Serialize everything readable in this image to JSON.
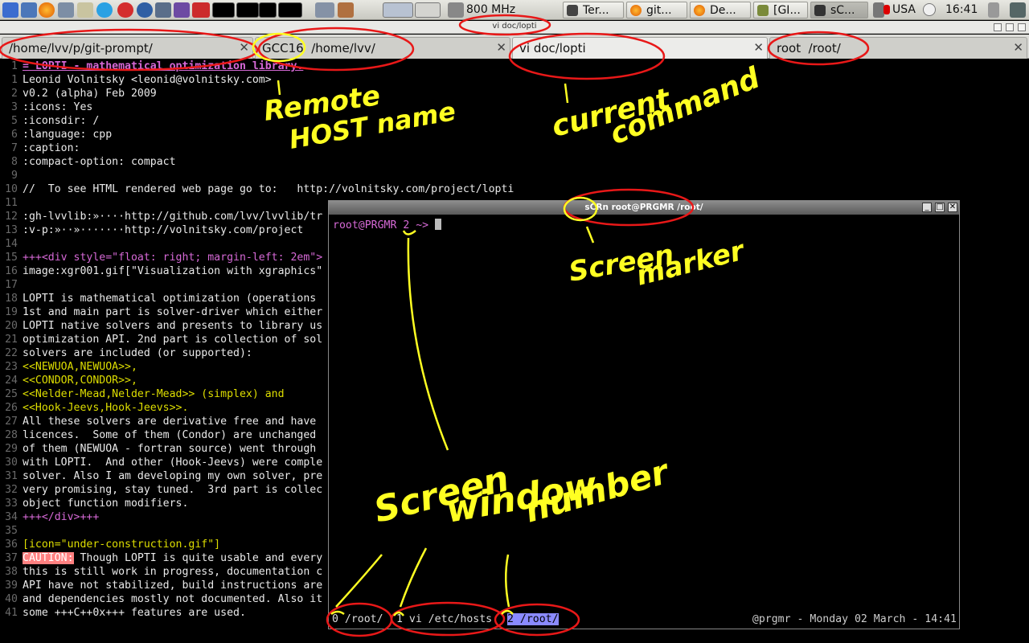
{
  "panel": {
    "cpu_freq": "800 MHz",
    "tasks": [
      {
        "label": "Ter...",
        "icon": "terminal-icon"
      },
      {
        "label": "git...",
        "icon": "firefox-icon"
      },
      {
        "label": "De...",
        "icon": "firefox-icon"
      },
      {
        "label": "[GI...",
        "icon": "gimp-icon"
      },
      {
        "label": "sC...",
        "icon": "terminal-icon"
      }
    ],
    "keyboard_layout": "USA",
    "clock": "16:41"
  },
  "window": {
    "title": "vi doc/lopti"
  },
  "tabs": [
    {
      "label": "/home/lvv/p/git-prompt/"
    },
    {
      "label": "GCC16  /home/lvv/"
    },
    {
      "label": "vi doc/lopti"
    },
    {
      "label": "root  /root/"
    }
  ],
  "editor": {
    "lines": [
      {
        "n": "1",
        "t": "= LOPTI - mathematical optimization library."
      },
      {
        "n": "1",
        "t": "Leonid Volnitsky <leonid@volnitsky.com>"
      },
      {
        "n": "2",
        "t": "v0.2 (alpha) Feb 2009"
      },
      {
        "n": "3",
        "t": ":icons: Yes"
      },
      {
        "n": "5",
        "t": ":iconsdir: /"
      },
      {
        "n": "6",
        "t": ":language: cpp"
      },
      {
        "n": "7",
        "t": ":caption:"
      },
      {
        "n": "8",
        "t": ":compact-option: compact"
      },
      {
        "n": "9",
        "t": ""
      },
      {
        "n": "10",
        "t": "//  To see HTML rendered web page go to:   http://volnitsky.com/project/lopti"
      },
      {
        "n": "11",
        "t": ""
      },
      {
        "n": "12",
        "t": ":gh-lvvlib:»····http://github.com/lvv/lvvlib/tr"
      },
      {
        "n": "13",
        "t": ":v-p:»··»·······http://volnitsky.com/project"
      },
      {
        "n": "14",
        "t": ""
      },
      {
        "n": "15",
        "t": "+++<div style=\"float: right; margin-left: 2em\">"
      },
      {
        "n": "16",
        "t": "image:xgr001.gif[\"Visualization with xgraphics\""
      },
      {
        "n": "17",
        "t": ""
      },
      {
        "n": "18",
        "t": "LOPTI is mathematical optimization (operations"
      },
      {
        "n": "19",
        "t": "1st and main part is solver-driver which either"
      },
      {
        "n": "20",
        "t": "LOPTI native solvers and presents to library us"
      },
      {
        "n": "21",
        "t": "optimization API. 2nd part is collection of sol"
      },
      {
        "n": "22",
        "t": "solvers are included (or supported):"
      },
      {
        "n": "23",
        "t": "<<NEWUOA,NEWUOA>>,"
      },
      {
        "n": "24",
        "t": "<<CONDOR,CONDOR>>,"
      },
      {
        "n": "25",
        "t": "<<Nelder-Mead,Nelder-Mead>> (simplex) and"
      },
      {
        "n": "26",
        "t": "<<Hook-Jeevs,Hook-Jeevs>>."
      },
      {
        "n": "27",
        "t": "All these solvers are derivative free and have"
      },
      {
        "n": "28",
        "t": "licences.  Some of them (Condor) are unchanged"
      },
      {
        "n": "29",
        "t": "of them (NEWUOA - fortran source) went through"
      },
      {
        "n": "30",
        "t": "with LOPTI.  And other (Hook-Jeevs) were comple"
      },
      {
        "n": "31",
        "t": "solver. Also I am developing my own solver, pre"
      },
      {
        "n": "32",
        "t": "very promising, stay tuned.  3rd part is collec"
      },
      {
        "n": "33",
        "t": "object function modifiers."
      },
      {
        "n": "34",
        "t": "+++</div>+++"
      },
      {
        "n": "35",
        "t": ""
      },
      {
        "n": "36",
        "t": "[icon=\"under-construction.gif\"]"
      },
      {
        "n": "37",
        "t": "CAUTION: Though LOPTI is quite usable and every"
      },
      {
        "n": "38",
        "t": "this is still work in progress, documentation c"
      },
      {
        "n": "39",
        "t": "API have not stabilized, build instructions are"
      },
      {
        "n": "40",
        "t": "and dependencies mostly not documented. Also it"
      },
      {
        "n": "41",
        "t": "some +++C++0x+++ features are used."
      }
    ]
  },
  "screen_window": {
    "title": "sCRn root@PRGMR  /root/",
    "prompt": "root@PRGMR 2 ~> ",
    "windows": [
      "0 /root/",
      "1 vi /etc/hosts",
      "2 /root/"
    ],
    "status_right": "@prgmr - Monday 02 March - 14:41"
  },
  "annotations": {
    "remote_host": "Remote",
    "remote_host_2": "HOST name",
    "current_command": "current",
    "current_command_2": "command",
    "screen_marker": "Screen",
    "screen_marker_2": "marker",
    "screen_window_number": "Screen",
    "screen_window_number_2": "window",
    "screen_window_number_3": "number"
  },
  "colors": {
    "annotation": "#ffff22",
    "circle": "#e81818",
    "prompt_magenta": "#d669d6"
  }
}
